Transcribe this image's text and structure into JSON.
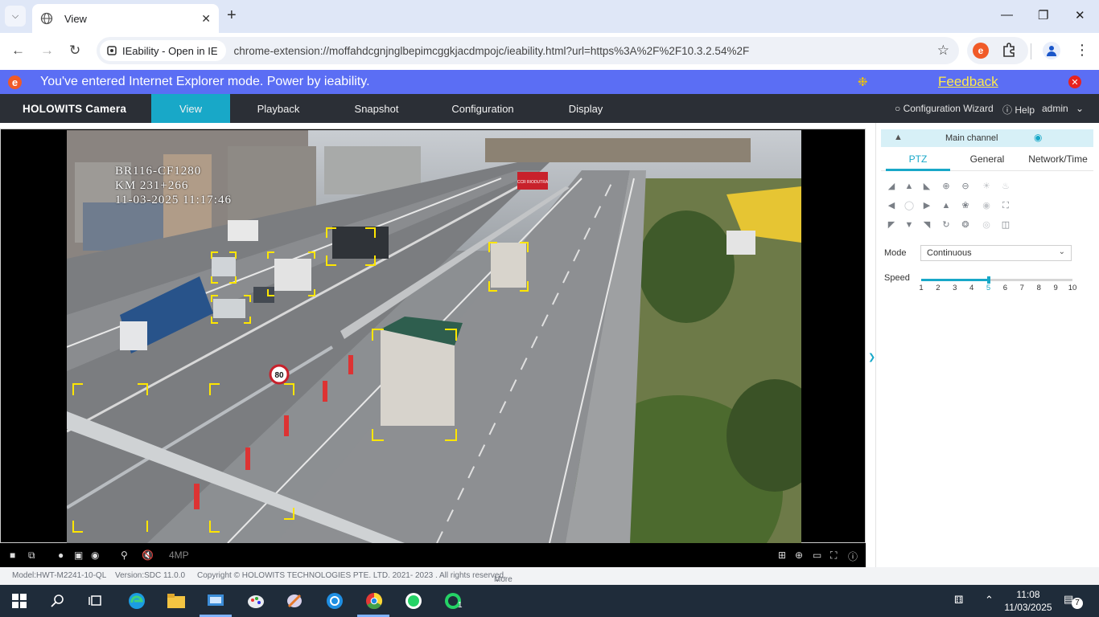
{
  "browser": {
    "tab_title": "View",
    "tab_list_icon": "chevron-down-icon",
    "new_tab_icon": "plus-icon",
    "ie_chip_label": "IEability - Open in IE",
    "url": "chrome-extension://moffahdcgnjnglbepimcggkjacdmpojc/ieability.html?url=https%3A%2F%2F10.3.2.54%2F"
  },
  "ie_banner": {
    "message": "You've entered Internet Explorer mode. Power by ieability.",
    "feedback_label": "Feedback",
    "logo_letter": "e"
  },
  "app": {
    "brand": "HOLOWITS Camera",
    "nav": [
      "View",
      "Playback",
      "Snapshot",
      "Configuration",
      "Display"
    ],
    "active_nav": "View",
    "config_wizard": "Configuration Wizard",
    "help": "Help",
    "user": "admin",
    "accent": "#18a8c8"
  },
  "video": {
    "osd_line1": "BR116-CF1280",
    "osd_line2": "KM 231+266",
    "osd_line3": "11-03-2025 11:17:46",
    "resolution_label": "4MP",
    "speed_sign": "80",
    "overhead_sign": "CCR RIODUTRA"
  },
  "panel": {
    "channel_label": "Main channel",
    "tabs": [
      "PTZ",
      "General",
      "Network/Time"
    ],
    "active_tab": "PTZ",
    "mode_label": "Mode",
    "mode_value": "Continuous",
    "speed_label": "Speed",
    "speed_ticks": [
      "1",
      "2",
      "3",
      "4",
      "5",
      "6",
      "7",
      "8",
      "9",
      "10"
    ],
    "speed_value": 5
  },
  "footer": {
    "model": "Model:HWT-M2241-10-QL",
    "version": "Version:SDC 11.0.0",
    "copyright": "Copyright © HOLOWITS TECHNOLOGIES PTE. LTD. 2021- 2023 . All rights reserved.",
    "more": "More"
  },
  "taskbar": {
    "time": "11:08",
    "date": "11/03/2025",
    "notification_count": "7",
    "whatsapp_badge": "1"
  }
}
